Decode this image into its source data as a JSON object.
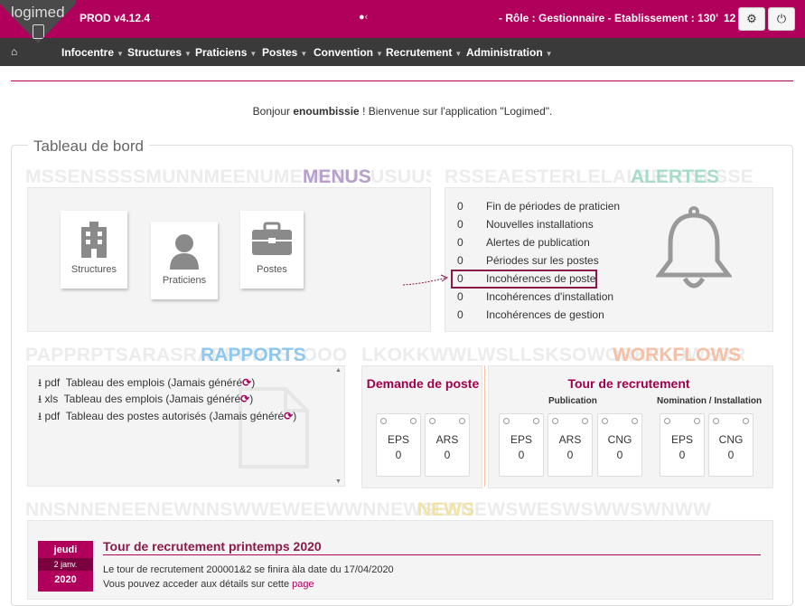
{
  "app": {
    "logo_text": "logimed",
    "version": "PROD v4.12.4",
    "user_glyph": "‹",
    "role": "- Rôle : Gestionnaire - Etablissement : 130'",
    "notif_count": "12"
  },
  "nav": {
    "items": [
      "Infocentre",
      "Structures",
      "Praticiens",
      "Postes",
      "Convention",
      "Recrutement",
      "Administration"
    ]
  },
  "welcome": {
    "prefix": "Bonjour",
    "username": "enoumbissie",
    "suffix": "! Bienvenue sur l'application \"Logimed\"."
  },
  "dashboard": {
    "title": "Tableau de bord",
    "menus": {
      "watermark": "MSSENSSSSMUNNMEENUMENUSUSUSUUSU",
      "title": "MENUS",
      "tiles": [
        "Structures",
        "Praticiens",
        "Postes"
      ]
    },
    "alerts": {
      "watermark": "RSSEAESTERLELALERTESLSSE",
      "title": "ALERTES",
      "rows": [
        {
          "count": "0",
          "label": "Fin de périodes de praticien"
        },
        {
          "count": "0",
          "label": "Nouvelles installations"
        },
        {
          "count": "0",
          "label": "Alertes de publication"
        },
        {
          "count": "0",
          "label": "Périodes sur les postes"
        },
        {
          "count": "0",
          "label": "Incohérences de poste"
        },
        {
          "count": "0",
          "label": "Incohérences d'installation"
        },
        {
          "count": "0",
          "label": "Incohérences de gestion"
        }
      ]
    },
    "reports": {
      "watermark": "PAPPRPTSARASRAPPORTSTOOO",
      "title": "RAPPORTS",
      "rows": [
        {
          "format": "pdf",
          "label": "Tableau des emplois (Jamais généré",
          "end": ")"
        },
        {
          "format": "xls",
          "label": "Tableau des emplois (Jamais généré",
          "end": ")"
        },
        {
          "format": "pdf",
          "label": "Tableau des postes autorisés (Jamais généré",
          "end": ")"
        }
      ]
    },
    "workflows": {
      "watermark": "LKOKKWWLWSLLSKSOWORKFLOWSRR",
      "title": "WORKFLOWS",
      "demande_title": "Demande de poste",
      "demande_cards": [
        {
          "label": "EPS",
          "value": "0"
        },
        {
          "label": "ARS",
          "value": "0"
        }
      ],
      "tour_title": "Tour de recrutement",
      "publication_label": "Publication",
      "publication_cards": [
        {
          "label": "EPS",
          "value": "0"
        },
        {
          "label": "ARS",
          "value": "0"
        },
        {
          "label": "CNG",
          "value": "0"
        }
      ],
      "nomination_label": "Nomination / Installation",
      "nomination_cards": [
        {
          "label": "EPS",
          "value": "0"
        },
        {
          "label": "CNG",
          "value": "0"
        }
      ]
    },
    "news": {
      "watermark": "NNSNNENEENEWNNSWWEWEEWWNNEWSEENEWSWESWSWWSWNWW",
      "title": "NEWS",
      "date_day": "jeudi",
      "date_date": "2 janv.",
      "date_year": "2020",
      "item_title": "Tour de recrutement printemps 2020",
      "item_text": "Le tour de recrutement 200001&2 se finira àla date du 17/04/2020",
      "item_link_prefix": "Vous pouvez acceder aux détails sur cette",
      "item_link": "page"
    }
  },
  "colors": {
    "brand": "#b0005c",
    "nav": "#3a3a3a",
    "menus": "#b7a1cc",
    "alerts": "#a6dcc8",
    "reports": "#8fc8ee",
    "workflows": "#f4c0a6",
    "news": "#f0e3a4"
  }
}
